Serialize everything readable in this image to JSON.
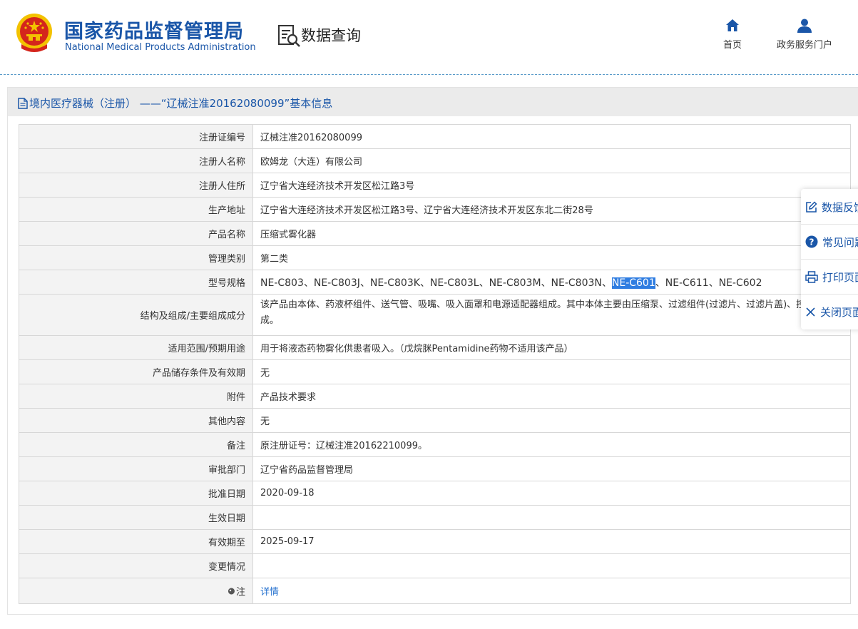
{
  "header": {
    "site_title": "国家药品监督管理局",
    "site_subtitle": "National Medical Products Administration",
    "query_title": "数据查询",
    "nav": {
      "home_label": "首页",
      "service_label": "政务服务门户"
    }
  },
  "panel": {
    "heading": "境内医疗器械（注册） ——“辽械注准20162080099”基本信息"
  },
  "table": {
    "rows": [
      {
        "label": "注册证编号",
        "value": "辽械注准20162080099"
      },
      {
        "label": "注册人名称",
        "value": "欧姆龙（大连）有限公司"
      },
      {
        "label": "注册人住所",
        "value": "辽宁省大连经济技术开发区松江路3号"
      },
      {
        "label": "生产地址",
        "value": "辽宁省大连经济技术开发区松江路3号、辽宁省大连经济技术开发区东北二街28号"
      },
      {
        "label": "产品名称",
        "value": "压缩式雾化器"
      },
      {
        "label": "管理类别",
        "value": "第二类"
      },
      {
        "label": "型号规格",
        "value_before": "NE-C803、NE-C803J、NE-C803K、NE-C803L、NE-C803M、NE-C803N、",
        "value_highlight": "NE-C601",
        "value_after": "、NE-C611、NE-C602"
      },
      {
        "label": "结构及组成/主要组成成分",
        "value": "该产品由本体、药液杯组件、送气管、吸嘴、吸入面罩和电源适配器组成。其中本体主要由压缩泵、过滤组件(过滤片、过滤片盖)、控制系统组成。"
      },
      {
        "label": "适用范围/预期用途",
        "value": "用于将液态药物雾化供患者吸入。（戊烷脒Pentamidine药物不适用该产品）"
      },
      {
        "label": "产品储存条件及有效期",
        "value": "无"
      },
      {
        "label": "附件",
        "value": "产品技术要求"
      },
      {
        "label": "其他内容",
        "value": "无"
      },
      {
        "label": "备注",
        "value": "原注册证号：辽械注准20162210099。"
      },
      {
        "label": "审批部门",
        "value": "辽宁省药品监督管理局"
      },
      {
        "label": "批准日期",
        "value": "2020-09-18"
      },
      {
        "label": "生效日期",
        "value": ""
      },
      {
        "label": "有效期至",
        "value": "2025-09-17"
      },
      {
        "label": "变更情况",
        "value": ""
      },
      {
        "label": "注",
        "value": "详情"
      }
    ]
  },
  "side_menu": {
    "feedback": "数据反馈",
    "faq": "常见问题",
    "print": "打印页面",
    "close": "关闭页面"
  },
  "colors": {
    "brand_blue": "#1a56a8",
    "header_band": "#ebebeb",
    "label_cell": "#f3f3f3",
    "selection": "#2f7de1",
    "link": "#2672cf",
    "emblem_red": "#d4251c",
    "emblem_gold": "#f3c200"
  },
  "icons": {
    "emblem": "national-emblem-icon",
    "query": "data-query-icon",
    "home": "home-icon",
    "service": "user-icon",
    "heading": "document-icon",
    "feedback": "edit-icon",
    "faq": "question-circle-icon",
    "print": "printer-icon",
    "close": "close-icon",
    "note": "tag-icon"
  }
}
